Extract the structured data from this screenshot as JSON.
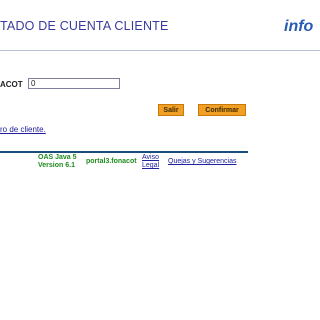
{
  "header": {
    "title": "TADO DE CUENTA CLIENTE",
    "logo_text": "info"
  },
  "form": {
    "field_label": "ACOT",
    "field_value": "0"
  },
  "buttons": {
    "salir": "Salir",
    "confirmar": "Confirmar"
  },
  "links": {
    "registro": "ro de cliente."
  },
  "footer": {
    "version_line1": "OAS Java 5",
    "version_line2": "Version 6.1",
    "server": "portal3.fonacot",
    "aviso_line1": "Aviso",
    "aviso_line2": "Legal",
    "quejas": "Quejas y Sugerencias"
  },
  "colors": {
    "title": "#3a3a9a",
    "button": "#f2a024",
    "footer_rule": "#1a4d7a",
    "footer_text": "#1f8a1f",
    "link": "#2020a0"
  }
}
